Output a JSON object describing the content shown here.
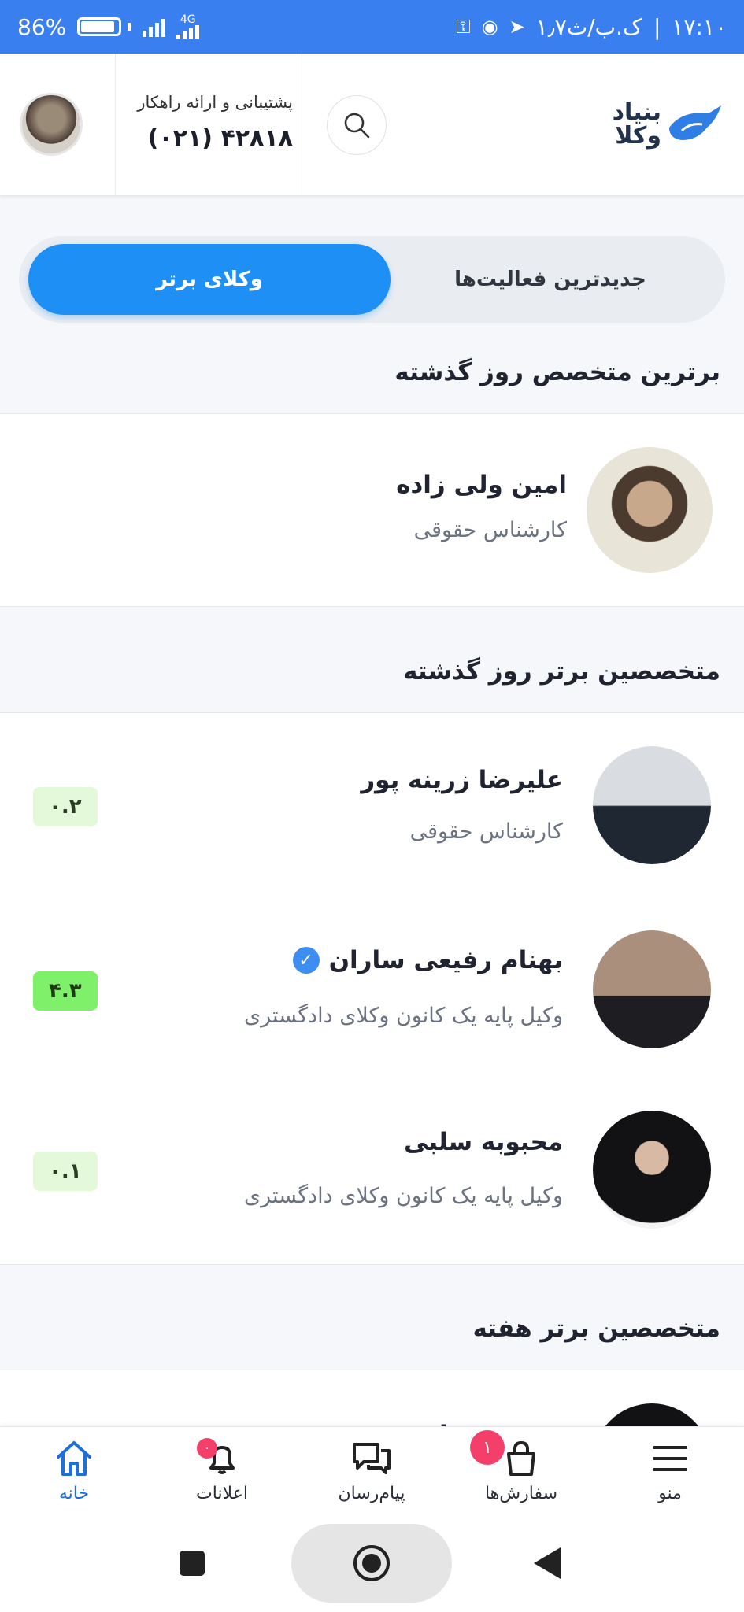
{
  "status_bar": {
    "battery": "86",
    "battery_level": 0.86,
    "network": "4G",
    "clock": "۱۷:۱۰",
    "date": "۱٫۷ک.ب/ث"
  },
  "header": {
    "logo_line1": "بنیاد",
    "logo_line2": "وکلا",
    "support_text": "پشتیبانی و ارائه راهکار",
    "support_phone": "۴۲۸۱۸ (۰۲۱)",
    "accent": "#1e90f5"
  },
  "tabs": [
    {
      "label": "وکلای برتر",
      "active": true
    },
    {
      "label": "جدیدترین فعالیت‌ها",
      "active": false
    }
  ],
  "sections": {
    "top_expert_title": "برترین متخصص روز گذشته",
    "top_experts_title": "متخصصین برتر روز گذشته",
    "weekly_title": "متخصصین برتر هفته"
  },
  "top_expert": {
    "name": "امین ولی زاده",
    "title": "کارشناس حقوقی"
  },
  "experts": [
    {
      "name": "علیرضا زرینه پور",
      "title": "کارشناس حقوقی",
      "rating": "۰.۲",
      "verified": false
    },
    {
      "name": "بهنام رفیعی ساران",
      "title": "وکیل پایه یک کانون وکلای دادگستری",
      "rating": "۴.۳",
      "verified": true
    },
    {
      "name": "محبوبه سلبی",
      "title": "وکیل پایه یک کانون وکلای دادگستری",
      "rating": "۰.۱",
      "verified": false
    }
  ],
  "weekly_partial": {
    "name": "محبوبه سلبی"
  },
  "bottom_nav": [
    {
      "label": "خانه",
      "icon": "home-icon"
    },
    {
      "label": "اعلانات",
      "icon": "bell-icon",
      "badge": "۰"
    },
    {
      "label": "پیام‌رسان",
      "icon": "chat-icon"
    },
    {
      "label": "سفارش‌ها",
      "icon": "bag-icon",
      "badge": "۱"
    },
    {
      "label": "منو",
      "icon": "menu-icon"
    }
  ]
}
